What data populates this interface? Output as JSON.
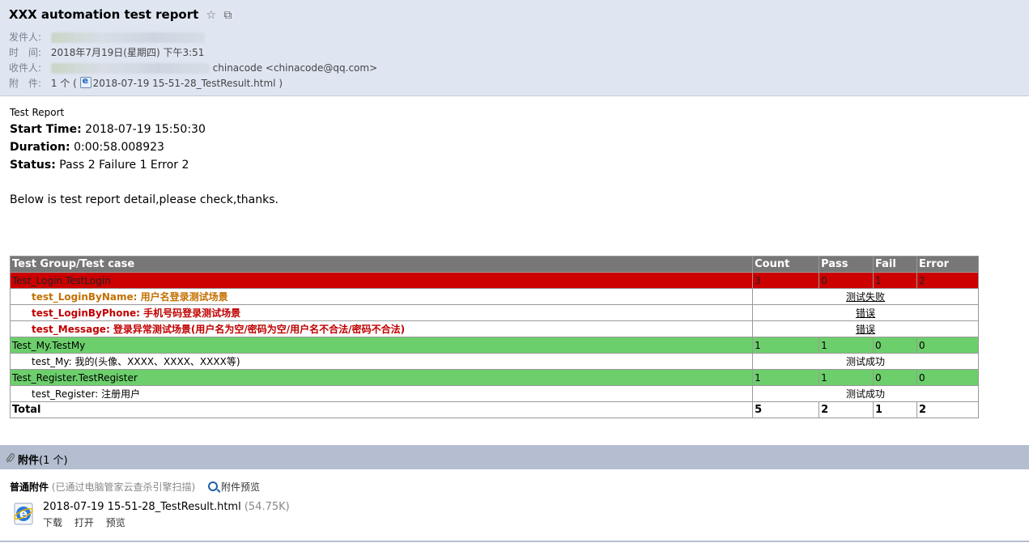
{
  "email": {
    "subject": "XXX automation test report",
    "subject_icons": {
      "star": "☆",
      "popout": "⧉"
    },
    "from_label": "发件人:",
    "time_label": "时　间:",
    "time_value": "2018年7月19日(星期四) 下午3:51",
    "to_label": "收件人:",
    "to_value": "chinacode <chinacode@qq.com>",
    "attach_label": "附　件:",
    "attach_count": "1 个 (",
    "attach_file": "2018-07-19 15-51-28_TestResult.html",
    "attach_close": ")"
  },
  "report": {
    "heading": "Test Report",
    "start_label": "Start Time:",
    "start_value": " 2018-07-19 15:50:30",
    "duration_label": "Duration:",
    "duration_value": " 0:00:58.008923",
    "status_label": "Status:",
    "status_value": " Pass 2 Failure 1 Error 2",
    "note": "Below is test report detail,please check,thanks."
  },
  "table": {
    "headers": [
      "Test Group/Test case",
      "Count",
      "Pass",
      "Fail",
      "Error"
    ],
    "groups": [
      {
        "name": "Test_Login.TestLogin",
        "count": "3",
        "pass": "0",
        "fail": "1",
        "error": "2",
        "cases": [
          {
            "name": "test_LoginByName:",
            "desc": " 用户名登录测试场景",
            "status": "测试失败"
          },
          {
            "name": "test_LoginByPhone:",
            "desc": " 手机号码登录测试场景",
            "status": "错误"
          },
          {
            "name": "test_Message:",
            "desc": " 登录异常测试场景(用户名为空/密码为空/用户名不合法/密码不合法)",
            "status": "错误"
          }
        ]
      },
      {
        "name": "Test_My.TestMy",
        "count": "1",
        "pass": "1",
        "fail": "0",
        "error": "0",
        "cases": [
          {
            "name": "test_My:",
            "desc": " 我的(头像、XXXX、XXXX、XXXX等)",
            "status": "测试成功"
          }
        ]
      },
      {
        "name": "Test_Register.TestRegister",
        "count": "1",
        "pass": "1",
        "fail": "0",
        "error": "0",
        "cases": [
          {
            "name": "test_Register:",
            "desc": " 注册用户",
            "status": "测试成功"
          }
        ]
      }
    ],
    "total": {
      "label": "Total",
      "count": "5",
      "pass": "2",
      "fail": "1",
      "error": "2"
    }
  },
  "attachments": {
    "bar_title": "附件",
    "bar_count": "(1 个)",
    "section_title": "普通附件",
    "scan_note": " (已通过电脑管家云查杀引擎扫描)",
    "preview_label": "附件预览",
    "file_name": "2018-07-19 15-51-28_TestResult.html",
    "file_size": " (54.75K)",
    "actions": [
      "下载",
      "打开",
      "预览"
    ]
  }
}
